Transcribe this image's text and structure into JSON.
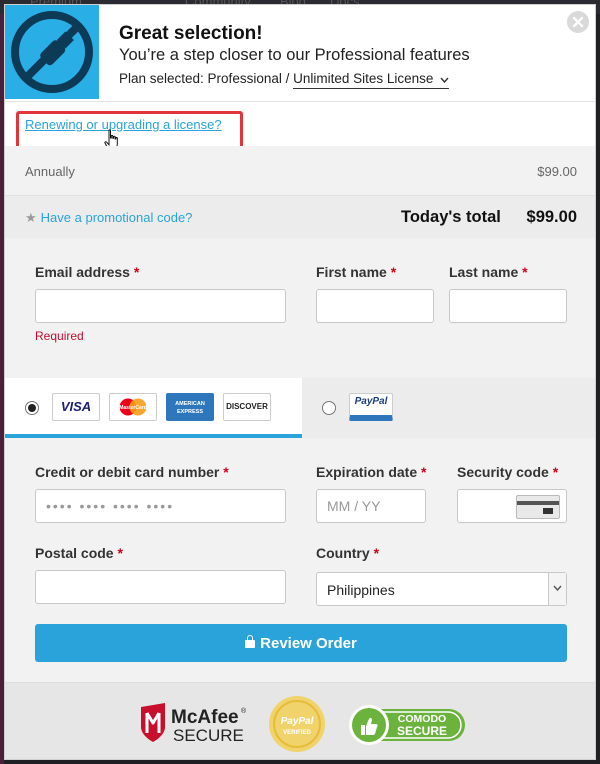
{
  "background_nav": {
    "items": [
      "Premium",
      "Community",
      "Blog",
      "Docs"
    ]
  },
  "header": {
    "title": "Great selection!",
    "subtitle": "You’re a step closer to our Professional features",
    "plan_label": "Plan selected: Professional /",
    "plan_option": "Unlimited Sites License"
  },
  "renew_link": "Renewing or upgrading a license?",
  "billing": {
    "cycle": "Annually",
    "price": "$99.00"
  },
  "promo": {
    "star": "★",
    "text": "Have a promotional code?"
  },
  "total": {
    "label": "Today's total",
    "amount": "$99.00"
  },
  "contact": {
    "email_label": "Email address",
    "first_label": "First name",
    "last_label": "Last name",
    "required_mark": "*",
    "email_error": "Required"
  },
  "payment_methods": {
    "cards": [
      "VISA",
      "MasterCard",
      "AMERICAN EXPRESS",
      "DISCOVER"
    ],
    "paypal": "PayPal",
    "selected": "card"
  },
  "card_form": {
    "number_label": "Credit or debit card number",
    "number_placeholder": "•••• •••• •••• ••••",
    "expiry_label": "Expiration date",
    "expiry_placeholder": "MM / YY",
    "security_label": "Security code",
    "postal_label": "Postal code",
    "country_label": "Country",
    "country_value": "Philippines",
    "review_button": "Review Order"
  },
  "badges": {
    "mcafee_line1": "McAfee",
    "mcafee_line2": "SECURE",
    "mcafee_reg": "®",
    "paypal_verified_line1": "PayPal",
    "paypal_verified_line2": "VERIFIED",
    "comodo_line1": "COMODO",
    "comodo_line2": "SECURE"
  },
  "colors": {
    "accent": "#29a3d9",
    "logo_bg": "#29aee6",
    "highlight_border": "#e0363b",
    "required": "#d0021b"
  }
}
